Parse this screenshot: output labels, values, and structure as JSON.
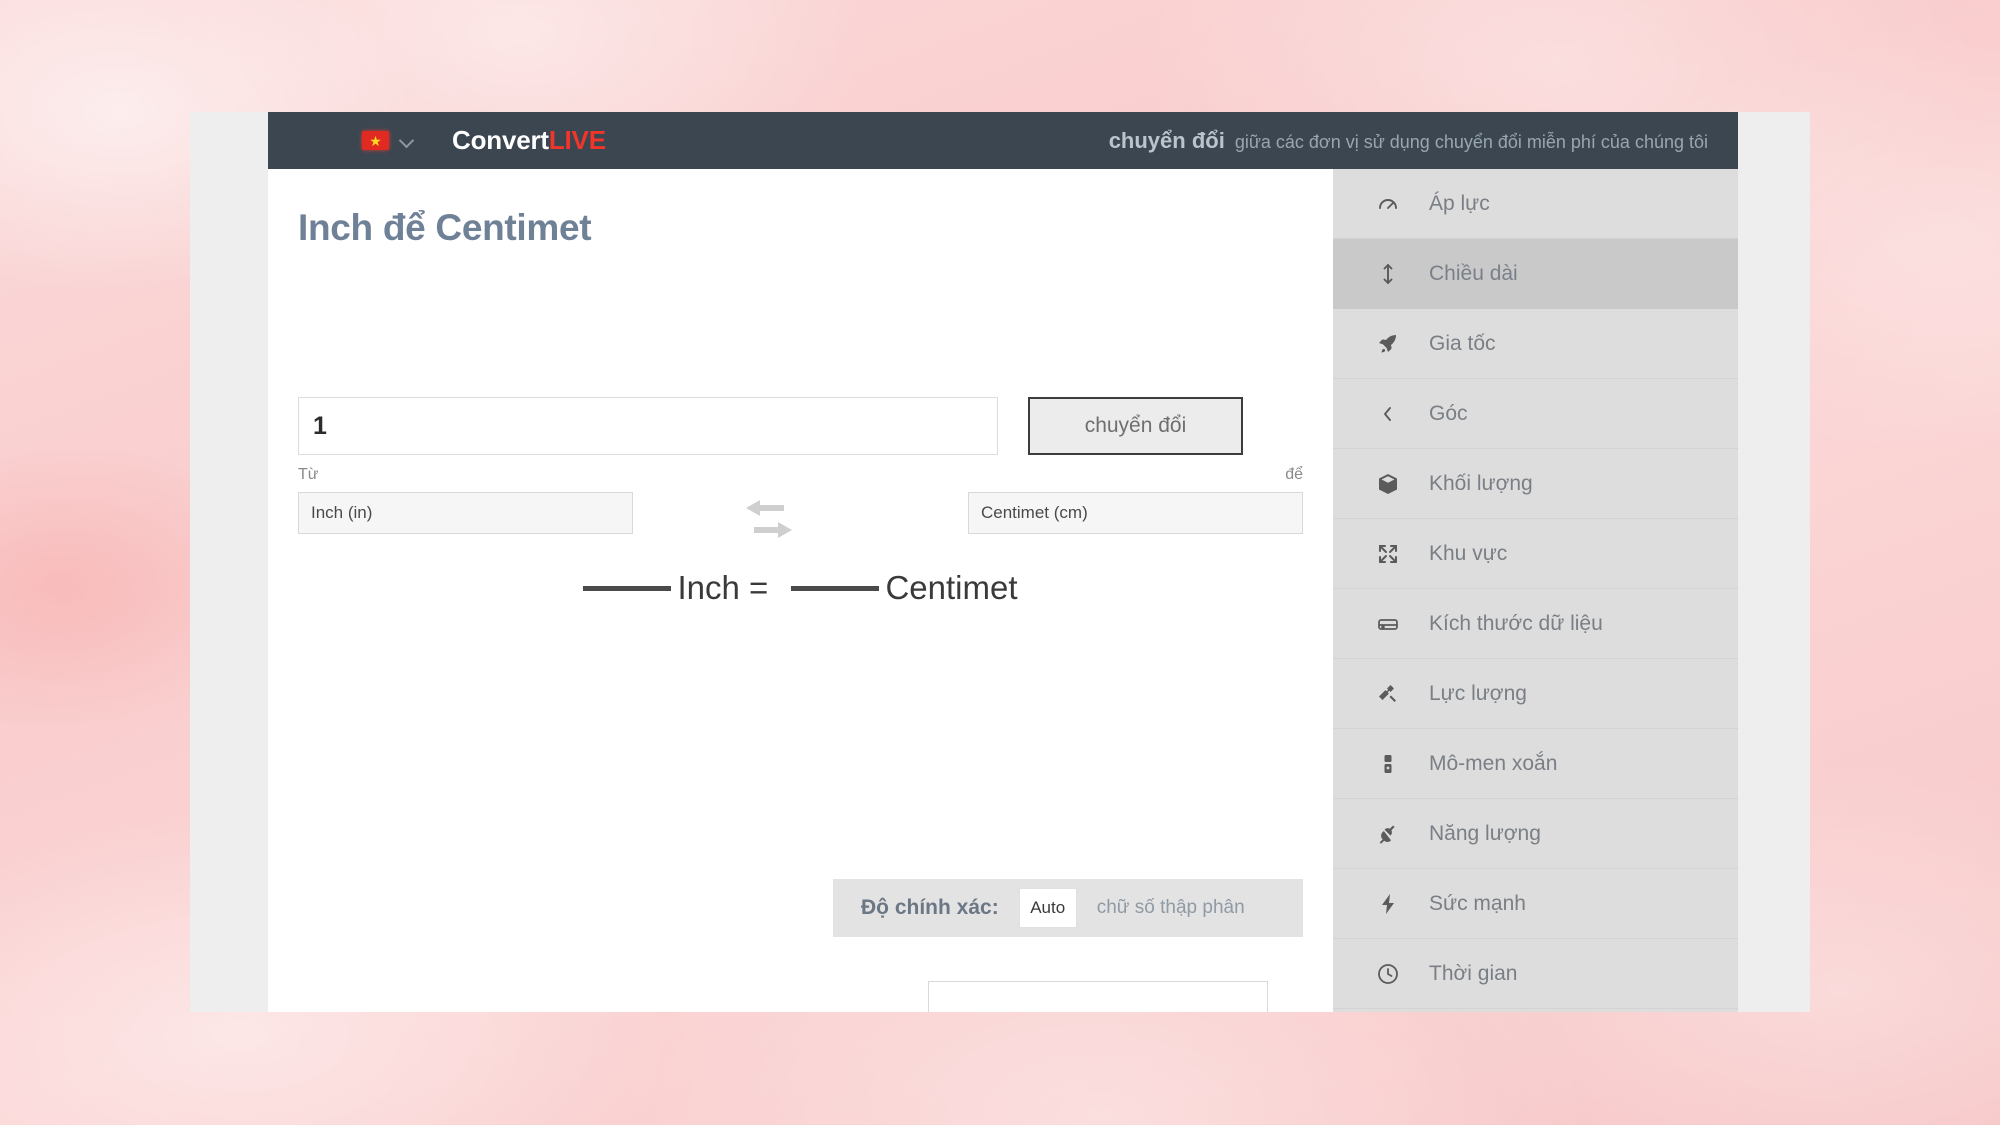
{
  "background": {
    "color": "#f9cccc"
  },
  "navbar": {
    "bg_color": "#3b4650",
    "flag_icon": "vietnam-flag-icon",
    "flag_star": "★",
    "language_chevron": "chevron-down-icon",
    "logo_part1": "Convert",
    "logo_part2": "LIVE",
    "logo_color1": "#ffffff",
    "logo_color2": "#f0352b",
    "tagline_strong": "chuyển đổi",
    "tagline_light": "giữa các đơn vị sử dụng chuyển đổi miễn phí của chúng tôi"
  },
  "main": {
    "page_title": "Inch để Centimet",
    "title_color": "#6f8196",
    "amount_value": "1",
    "amount_placeholder": "1",
    "convert_label": "chuyển đổi",
    "label_from": "Từ",
    "label_to": "để",
    "unit_from": "Inch (in)",
    "unit_to": "Centimet (cm)",
    "swap_icon": "swap-arrows-icon",
    "result": {
      "left_blank": "",
      "left_unit": "Inch",
      "equals": "=",
      "right_blank": "",
      "right_unit": "Centimet"
    },
    "precision": {
      "label": "Độ chính xác:",
      "value": "Auto",
      "placeholder": "Auto",
      "suffix": "chữ số thập phân"
    },
    "bottom_clipped_text": ""
  },
  "sidebar": {
    "bg_color": "#dddddd",
    "active_color": "#c9c9c9",
    "items": [
      {
        "label": "Áp lực",
        "icon": "gauge-icon",
        "active": false
      },
      {
        "label": "Chiều dài",
        "icon": "vertical-arrows-icon",
        "active": true
      },
      {
        "label": "Gia tốc",
        "icon": "rocket-icon",
        "active": false
      },
      {
        "label": "Góc",
        "icon": "angle-chevron-icon",
        "active": false
      },
      {
        "label": "Khối lượng",
        "icon": "box-icon",
        "active": false
      },
      {
        "label": "Khu vực",
        "icon": "expand-arrows-icon",
        "active": false
      },
      {
        "label": "Kích thước dữ liệu",
        "icon": "hard-drive-icon",
        "active": false
      },
      {
        "label": "Lực lượng",
        "icon": "hammer-icon",
        "active": false
      },
      {
        "label": "Mô-men xoắn",
        "icon": "torque-icon",
        "active": false
      },
      {
        "label": "Năng lượng",
        "icon": "plug-icon",
        "active": false
      },
      {
        "label": "Sức mạnh",
        "icon": "lightning-bolt-icon",
        "active": false
      },
      {
        "label": "Thời gian",
        "icon": "clock-icon",
        "active": false
      }
    ]
  }
}
